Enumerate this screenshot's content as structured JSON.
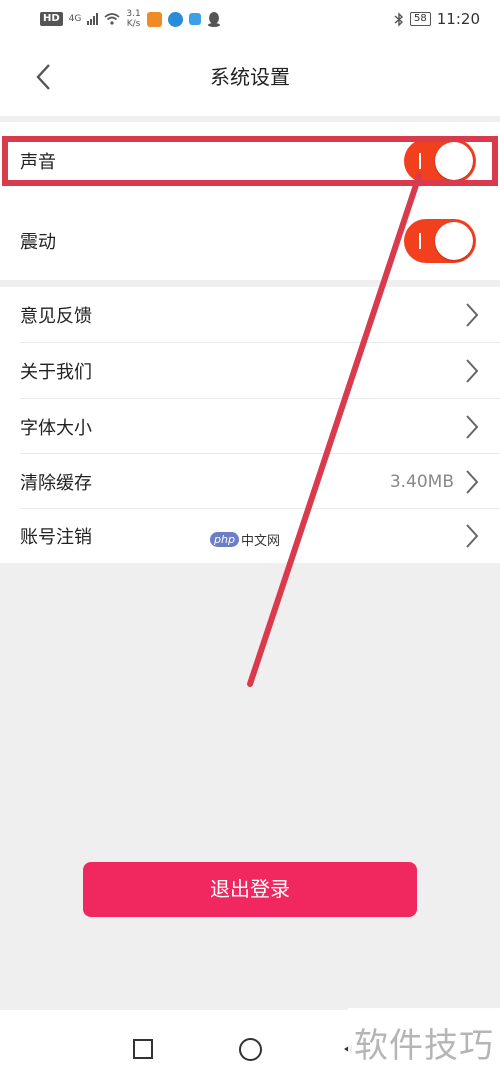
{
  "status_bar": {
    "hd": "HD",
    "network": "4G",
    "speed_value": "3.1",
    "speed_unit": "K/s",
    "battery": "58",
    "time": "11:20"
  },
  "header": {
    "title": "系统设置"
  },
  "settings": {
    "sound_label": "声音",
    "vibrate_label": "震动",
    "sound_on": true,
    "vibrate_on": true,
    "items": [
      {
        "label": "意见反馈",
        "value": ""
      },
      {
        "label": "关于我们",
        "value": ""
      },
      {
        "label": "字体大小",
        "value": ""
      },
      {
        "label": "清除缓存",
        "value": "3.40MB"
      },
      {
        "label": "账号注销",
        "value": ""
      }
    ]
  },
  "logout_label": "退出登录",
  "watermarks": {
    "php_logo": "php",
    "php_text": "中文网",
    "site": "软件技巧"
  },
  "colors": {
    "toggle_on": "#f2401f",
    "logout_button": "#f0285f",
    "annotation": "#d93a4c"
  }
}
